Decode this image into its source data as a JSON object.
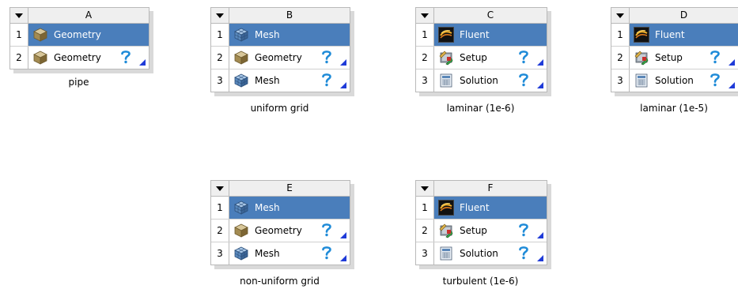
{
  "icons": {
    "geometry": "geometry-icon",
    "mesh": "mesh-icon",
    "fluent": "fluent-icon",
    "setup": "setup-icon",
    "solution": "solution-icon",
    "state": "question-mark-icon",
    "menu": "dropdown-arrow-icon"
  },
  "colors": {
    "selected": "#4a7ebb",
    "border": "#b9b9b9",
    "header": "#efefef",
    "question": "#1f8bd8",
    "corner": "#1f3bd8"
  },
  "systems": [
    {
      "letter": "A",
      "name": "pipe",
      "rows": [
        {
          "num": "1",
          "label": "Geometry",
          "icon": "geometry"
        },
        {
          "num": "2",
          "label": "Geometry",
          "icon": "geometry"
        }
      ]
    },
    {
      "letter": "B",
      "name": "uniform grid",
      "rows": [
        {
          "num": "1",
          "label": "Mesh",
          "icon": "mesh"
        },
        {
          "num": "2",
          "label": "Geometry",
          "icon": "geometry"
        },
        {
          "num": "3",
          "label": "Mesh",
          "icon": "mesh"
        }
      ]
    },
    {
      "letter": "C",
      "name": "laminar (1e-6)",
      "rows": [
        {
          "num": "1",
          "label": "Fluent",
          "icon": "fluent"
        },
        {
          "num": "2",
          "label": "Setup",
          "icon": "setup"
        },
        {
          "num": "3",
          "label": "Solution",
          "icon": "solution"
        }
      ]
    },
    {
      "letter": "D",
      "name": "laminar (1e-5)",
      "rows": [
        {
          "num": "1",
          "label": "Fluent",
          "icon": "fluent"
        },
        {
          "num": "2",
          "label": "Setup",
          "icon": "setup"
        },
        {
          "num": "3",
          "label": "Solution",
          "icon": "solution"
        }
      ]
    },
    {
      "letter": "E",
      "name": "non-uniform grid",
      "rows": [
        {
          "num": "1",
          "label": "Mesh",
          "icon": "mesh"
        },
        {
          "num": "2",
          "label": "Geometry",
          "icon": "geometry"
        },
        {
          "num": "3",
          "label": "Mesh",
          "icon": "mesh"
        }
      ]
    },
    {
      "letter": "F",
      "name": "turbulent (1e-6)",
      "rows": [
        {
          "num": "1",
          "label": "Fluent",
          "icon": "fluent"
        },
        {
          "num": "2",
          "label": "Setup",
          "icon": "setup"
        },
        {
          "num": "3",
          "label": "Solution",
          "icon": "solution"
        }
      ]
    }
  ]
}
